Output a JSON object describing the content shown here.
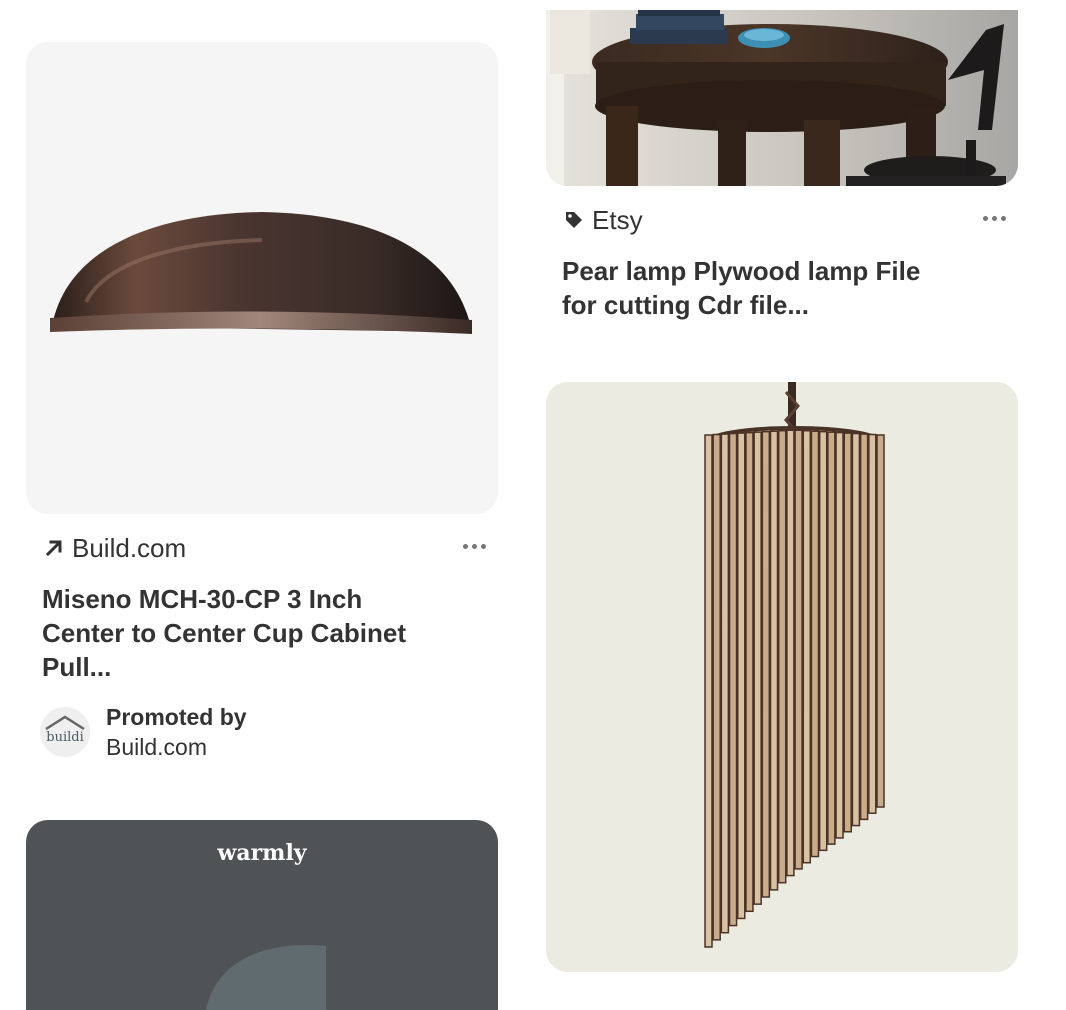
{
  "pins": [
    {
      "id": "table",
      "source": "Etsy",
      "source_icon": "tag-icon",
      "title_line1": "Pear lamp Plywood lamp File",
      "title_line2": "for cutting Cdr file...",
      "more_label": "More options"
    },
    {
      "id": "cabinet-pull",
      "source": "Build.com",
      "source_icon": "arrow-up-right-icon",
      "title_line1": "Miseno MCH-30-CP 3 Inch",
      "title_line2": "Center to Center Cup Cabinet",
      "title_line3": "Pull...",
      "promoted_by_label": "Promoted by",
      "promoted_by_name": "Build.com",
      "avatar_text": "buildi",
      "more_label": "More options"
    },
    {
      "id": "wooden-lamp"
    },
    {
      "id": "warmly",
      "logo_text": "warmly"
    }
  ],
  "colors": {
    "text": "#333333",
    "icon_gray": "#767676",
    "card_gray": "#f5f5f5",
    "warmly_bg": "#505356"
  }
}
